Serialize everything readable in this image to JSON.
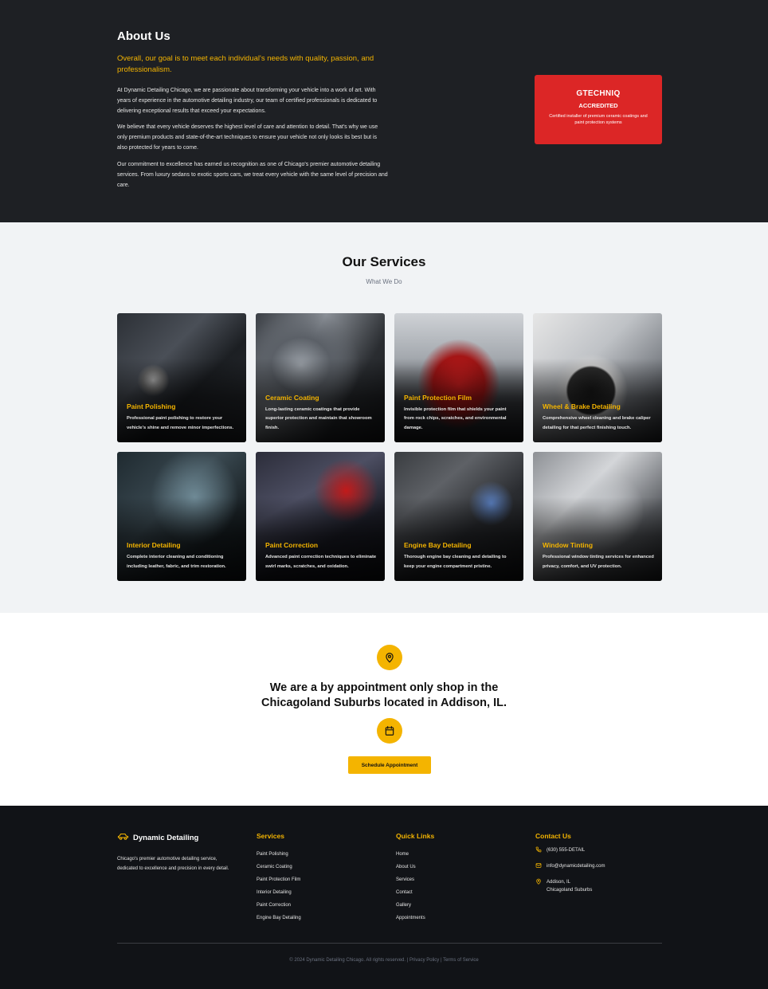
{
  "about": {
    "title": "About Us",
    "lead": "Overall, our goal is to meet each individual's needs with quality, passion, and professionalism.",
    "paragraphs": [
      "At Dynamic Detailing Chicago, we are passionate about transforming your vehicle into a work of art. With years of experience in the automotive detailing industry, our team of certified professionals is dedicated to delivering exceptional results that exceed your expectations.",
      "We believe that every vehicle deserves the highest level of care and attention to detail. That's why we use only premium products and state-of-the-art techniques to ensure your vehicle not only looks its best but is also protected for years to come.",
      "Our commitment to excellence has earned us recognition as one of Chicago's premier automotive detailing services. From luxury sedans to exotic sports cars, we treat every vehicle with the same level of precision and care."
    ],
    "badge": {
      "name": "GTECHNIQ",
      "status": "ACCREDITED",
      "text": "Certified installer of premium ceramic coatings and paint protection systems"
    }
  },
  "services": {
    "title": "Our Services",
    "subtitle": "What We Do",
    "items": [
      {
        "title": "Paint Polishing",
        "desc": "Professional paint polishing to restore your vehicle's shine and remove minor imperfections."
      },
      {
        "title": "Ceramic Coating",
        "desc": "Long-lasting ceramic coatings that provide superior protection and maintain that showroom finish."
      },
      {
        "title": "Paint Protection Film",
        "desc": "Invisible protection film that shields your paint from rock chips, scratches, and environmental damage."
      },
      {
        "title": "Wheel & Brake Detailing",
        "desc": "Comprehensive wheel cleaning and brake caliper detailing for that perfect finishing touch."
      },
      {
        "title": "Interior Detailing",
        "desc": "Complete interior cleaning and conditioning including leather, fabric, and trim restoration."
      },
      {
        "title": "Paint Correction",
        "desc": "Advanced paint correction techniques to eliminate swirl marks, scratches, and oxidation."
      },
      {
        "title": "Engine Bay Detailing",
        "desc": "Thorough engine bay cleaning and detailing to keep your engine compartment pristine."
      },
      {
        "title": "Window Tinting",
        "desc": "Professional window tinting services for enhanced privacy, comfort, and UV protection."
      }
    ]
  },
  "location": {
    "heading_line1": "We are a by appointment only shop in the",
    "heading_line2": "Chicagoland Suburbs located in Addison, IL.",
    "button": "Schedule Appointment"
  },
  "footer": {
    "brand": "Dynamic Detailing",
    "description": "Chicago's premier automotive detailing service, dedicated to excellence and precision in every detail.",
    "services_title": "Services",
    "services": [
      "Paint Polishing",
      "Ceramic Coating",
      "Paint Protection Film",
      "Interior Detailing",
      "Paint Correction",
      "Engine Bay Detailing"
    ],
    "links_title": "Quick Links",
    "links": [
      "Home",
      "About Us",
      "Services",
      "Contact",
      "Gallery",
      "Appointments"
    ],
    "contact_title": "Contact Us",
    "phone": "(630) 555-DETAIL",
    "email": "info@dynamicdetailing.com",
    "address_line1": "Addison, IL",
    "address_line2": "Chicagoland Suburbs",
    "copyright": "© 2024 Dynamic Detailing Chicago. All rights reserved. | Privacy Policy | Terms of Service"
  },
  "colors": {
    "accent": "#f4b400",
    "dark": "#1e2024",
    "footer": "#111317",
    "badge": "#dc2626"
  }
}
